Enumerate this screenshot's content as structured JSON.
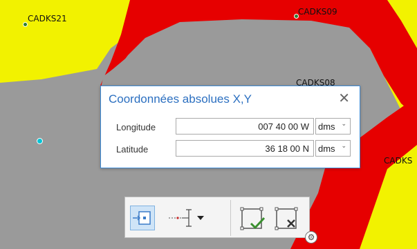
{
  "map": {
    "colors": {
      "background": "#9a9a9a",
      "yellow": "#f2f200",
      "red": "#e60000",
      "gray": "#9a9a9a"
    },
    "labels": [
      "CADKS21",
      "CADKS09",
      "CADKS08",
      "CADKS"
    ]
  },
  "dialog": {
    "title": "Coordonnées absolues X,Y",
    "close_icon": "close-icon",
    "longitude": {
      "label": "Longitude",
      "value": "007 40 00 W",
      "unit": "dms"
    },
    "latitude": {
      "label": "Latitude",
      "value": "36 18 00 N",
      "unit": "dms"
    },
    "accent": "#2b6fc0"
  },
  "toolbar": {
    "buttons": [
      {
        "name": "absolute-xy-button",
        "icon": "absolute-xy-icon",
        "selected": true
      },
      {
        "name": "construction-tool-button",
        "icon": "line-segment-icon"
      },
      {
        "name": "finish-button",
        "icon": "finish-check-icon"
      },
      {
        "name": "cancel-button",
        "icon": "cancel-x-icon"
      }
    ],
    "settings_icon": "gear-icon"
  }
}
